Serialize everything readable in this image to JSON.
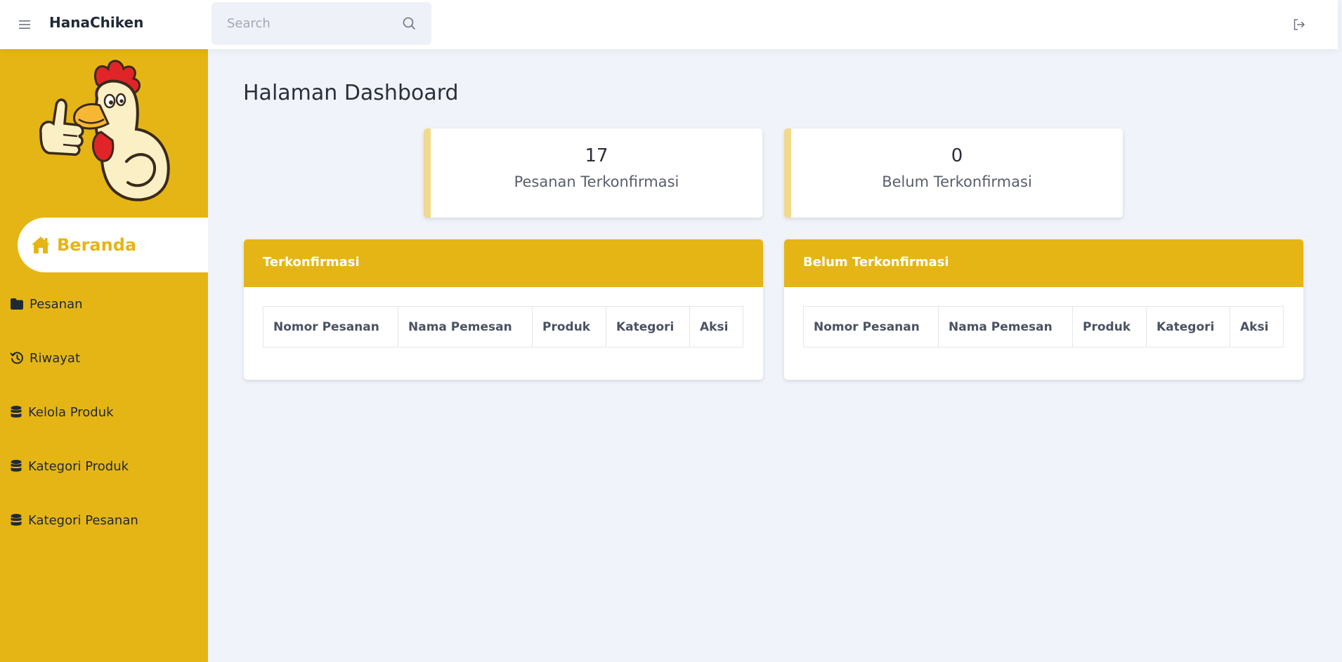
{
  "header": {
    "brand": "HanaChiken",
    "search_placeholder": "Search"
  },
  "sidebar": {
    "active": {
      "label": "Beranda",
      "icon": "home-icon"
    },
    "items": [
      {
        "label": "Pesanan",
        "icon": "folder-icon"
      },
      {
        "label": "Riwayat",
        "icon": "history-icon"
      },
      {
        "label": "Kelola Produk",
        "icon": "database-icon"
      },
      {
        "label": "Kategori Produk",
        "icon": "database-icon"
      },
      {
        "label": "Kategori Pesanan",
        "icon": "database-icon"
      }
    ]
  },
  "main": {
    "title": "Halaman Dashboard",
    "stats": [
      {
        "value": "17",
        "label": "Pesanan Terkonfirmasi"
      },
      {
        "value": "0",
        "label": "Belum Terkonfirmasi"
      }
    ],
    "panels": [
      {
        "title": "Terkonfirmasi",
        "columns": [
          "Nomor Pesanan",
          "Nama Pemesan",
          "Produk",
          "Kategori",
          "Aksi"
        ]
      },
      {
        "title": "Belum Terkonfirmasi",
        "columns": [
          "Nomor Pesanan",
          "Nama Pemesan",
          "Produk",
          "Kategori",
          "Aksi"
        ]
      }
    ]
  },
  "colors": {
    "accent": "#e5b515",
    "stat_border": "#f2da8c",
    "background": "#f0f4fa"
  }
}
